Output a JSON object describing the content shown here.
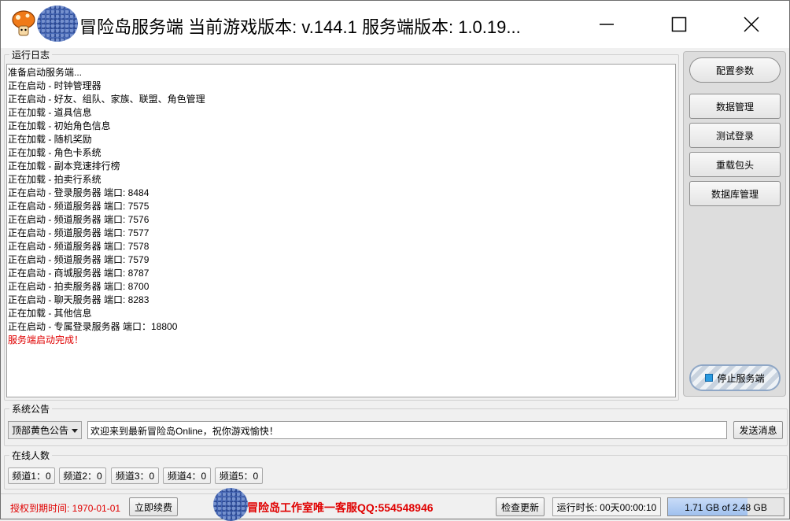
{
  "titlebar": {
    "title": "冒险岛服务端  当前游戏版本: v.144.1 服务端版本: 1.0.19..."
  },
  "log_group": {
    "legend": "运行日志",
    "lines": [
      {
        "text": "准备启动服务端...",
        "color": "#000000"
      },
      {
        "text": "正在启动 - 时钟管理器",
        "color": "#000000"
      },
      {
        "text": "正在启动 - 好友、组队、家族、联盟、角色管理",
        "color": "#000000"
      },
      {
        "text": "正在加载 - 道具信息",
        "color": "#000000"
      },
      {
        "text": "正在加载 - 初始角色信息",
        "color": "#000000"
      },
      {
        "text": "正在加载 - 随机奖励",
        "color": "#000000"
      },
      {
        "text": "正在加载 - 角色卡系统",
        "color": "#000000"
      },
      {
        "text": "正在加载 - 副本竞速排行榜",
        "color": "#000000"
      },
      {
        "text": "正在加载 - 拍卖行系统",
        "color": "#000000"
      },
      {
        "text": "正在启动 - 登录服务器 端口: 8484",
        "color": "#000000"
      },
      {
        "text": "正在启动 - 频道服务器 端口: 7575",
        "color": "#000000"
      },
      {
        "text": "正在启动 - 频道服务器 端口: 7576",
        "color": "#000000"
      },
      {
        "text": "正在启动 - 频道服务器 端口: 7577",
        "color": "#000000"
      },
      {
        "text": "正在启动 - 频道服务器 端口: 7578",
        "color": "#000000"
      },
      {
        "text": "正在启动 - 频道服务器 端口: 7579",
        "color": "#000000"
      },
      {
        "text": "正在启动 - 商城服务器 端口: 8787",
        "color": "#000000"
      },
      {
        "text": "正在启动 - 拍卖服务器 端口: 8700",
        "color": "#000000"
      },
      {
        "text": "正在启动 - 聊天服务器 端口: 8283",
        "color": "#000000"
      },
      {
        "text": "正在加载 - 其他信息",
        "color": "#000000"
      },
      {
        "text": "正在启动 - 专属登录服务器 端口：18800",
        "color": "#000000"
      },
      {
        "text": "服务端启动完成！",
        "color": "#e00000"
      }
    ]
  },
  "side_panel": {
    "config_label": "配置参数",
    "data_mgmt_label": "数据管理",
    "test_login_label": "测试登录",
    "reload_header_label": "重载包头",
    "db_mgmt_label": "数据库管理",
    "stop_label": "停止服务端"
  },
  "notice_group": {
    "legend": "系统公告",
    "type_selected": "顶部黄色公告",
    "message_value": "欢迎来到最新冒险岛Online，祝你游戏愉快！",
    "send_label": "发送消息"
  },
  "online_group": {
    "legend": "在线人数",
    "channels": [
      "频道1：0",
      "频道2：0",
      "频道3：0",
      "频道4：0",
      "频道5：0"
    ]
  },
  "statusbar": {
    "license_text": "授权到期时间: 1970-01-01",
    "renew_label": "立即续费",
    "studio_text": "冒险岛工作室唯一客服QQ:554548946",
    "check_update_label": "检查更新",
    "uptime_text": "运行时长: 00天00:00:10",
    "memory_text": "1.71 GB of 2.48 GB",
    "memory_fraction": 0.69
  },
  "colors": {
    "accent_red": "#e00000",
    "stop_indicator": "#2b9be0"
  }
}
